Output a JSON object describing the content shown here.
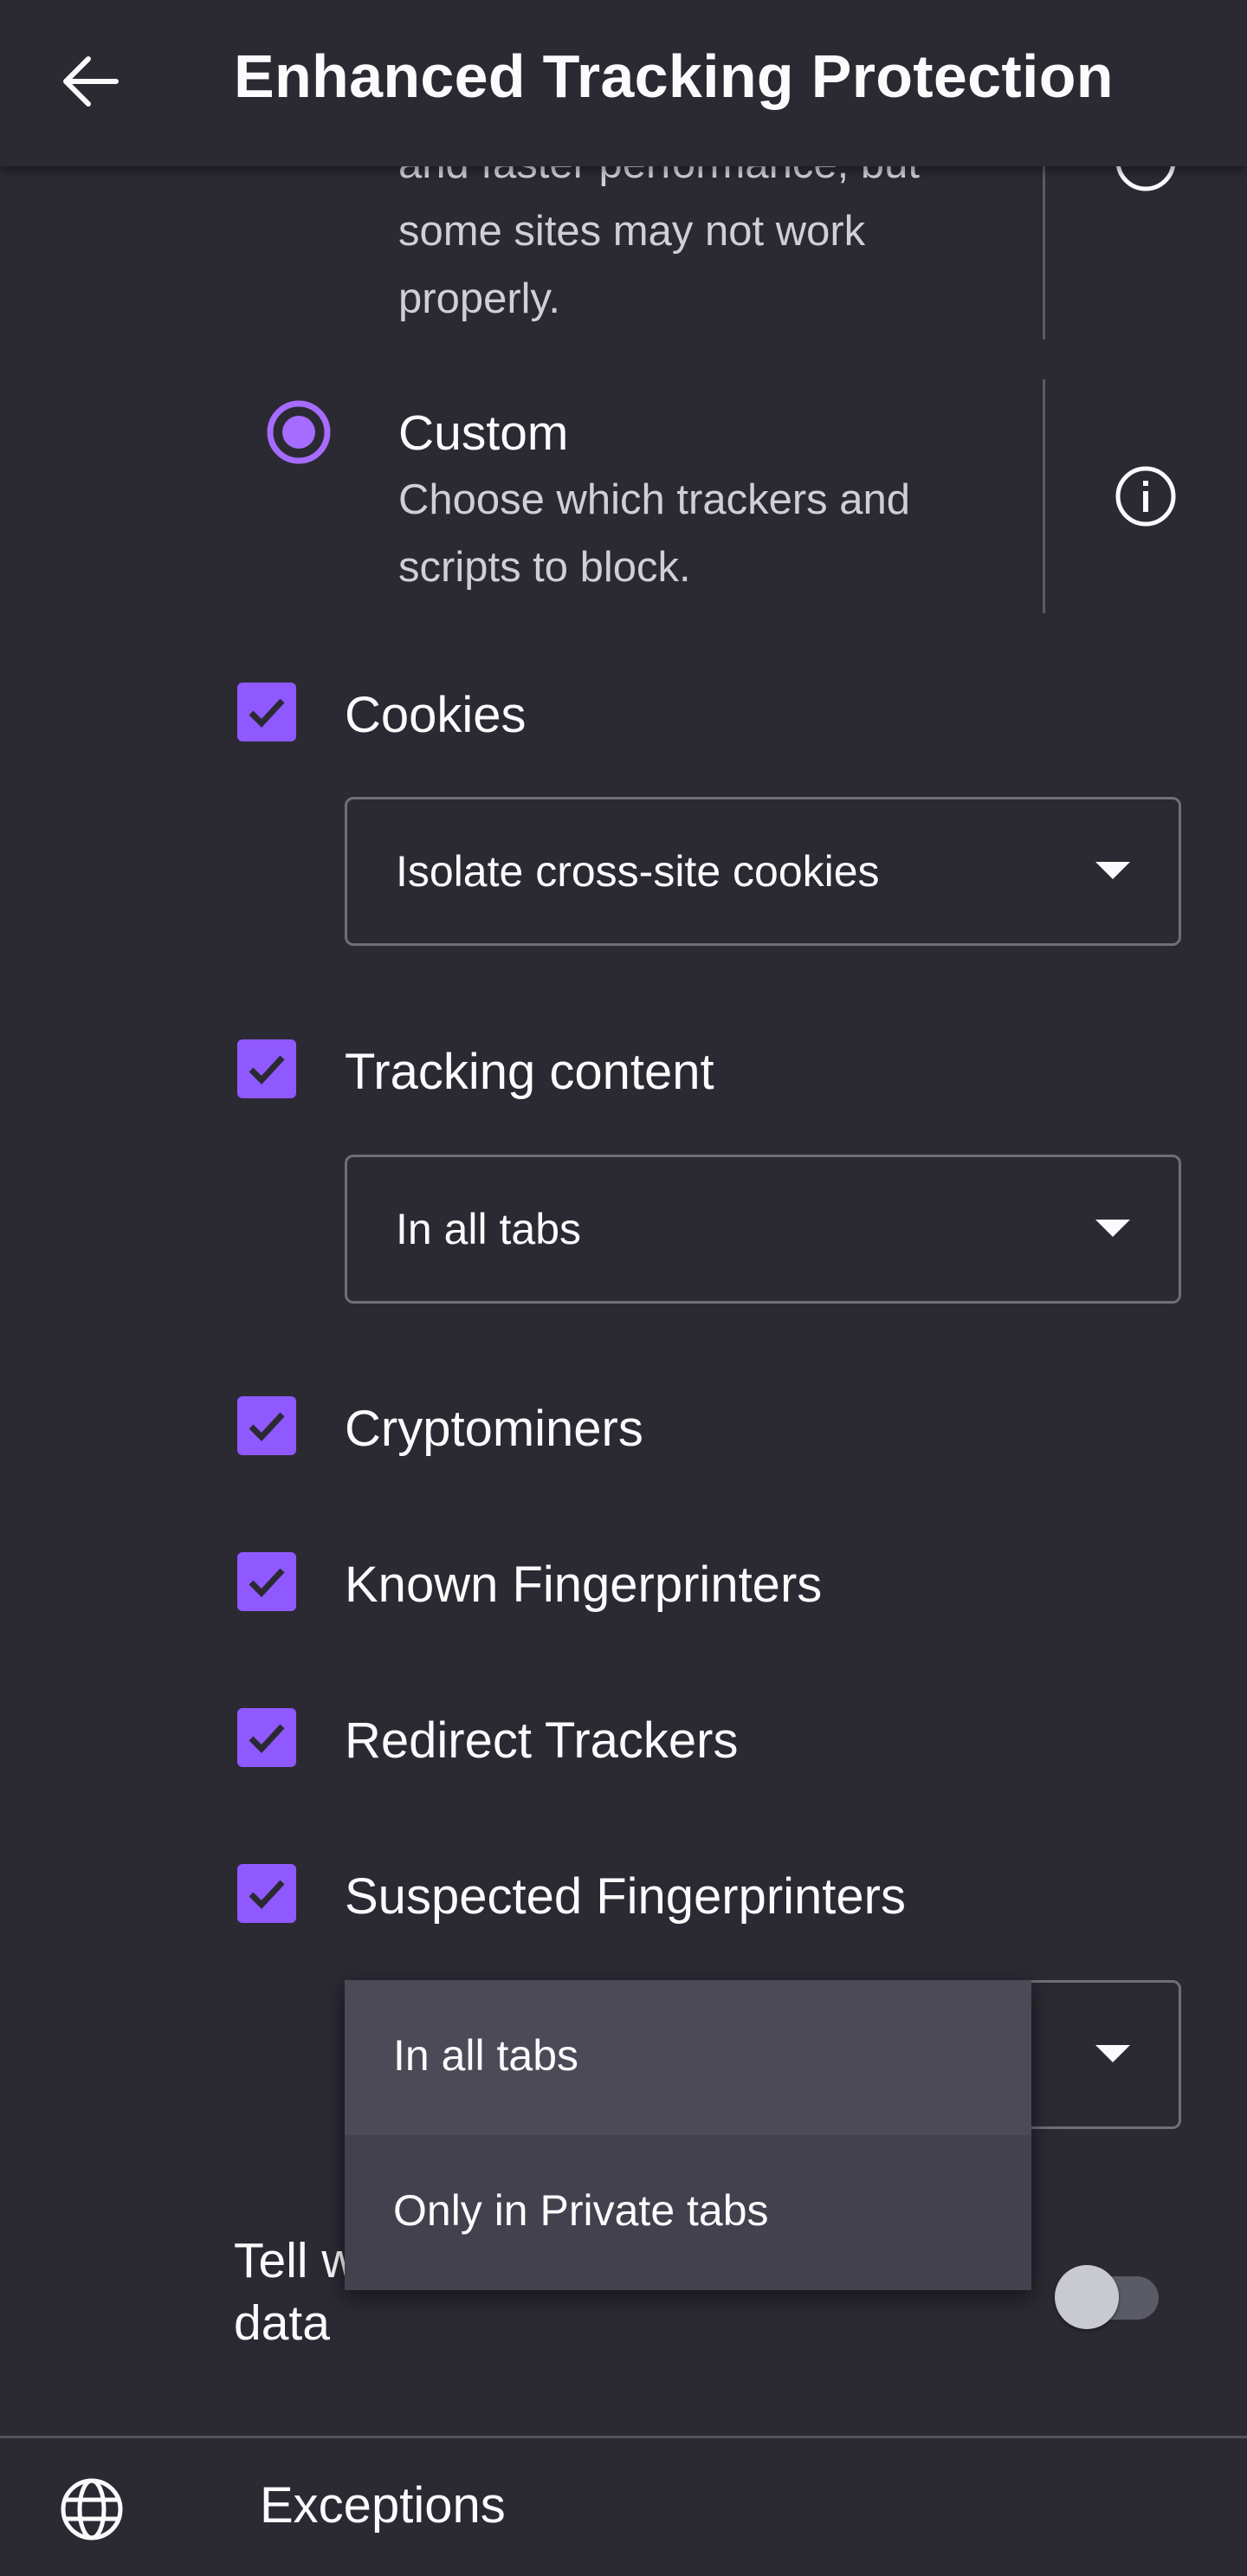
{
  "header": {
    "title": "Enhanced Tracking Protection",
    "back_icon": "arrow-left-icon"
  },
  "strict_option": {
    "description_lines": [
      "and faster performance, but",
      "some sites may not work",
      "properly."
    ]
  },
  "custom_option": {
    "title": "Custom",
    "description_lines": [
      "Choose which trackers and",
      "scripts to block."
    ],
    "selected": true
  },
  "checkboxes": [
    {
      "label": "Cookies",
      "checked": true
    },
    {
      "label": "Tracking content",
      "checked": true
    },
    {
      "label": "Cryptominers",
      "checked": true
    },
    {
      "label": "Known Fingerprinters",
      "checked": true
    },
    {
      "label": "Redirect Trackers",
      "checked": true
    },
    {
      "label": "Suspected Fingerprinters",
      "checked": true
    }
  ],
  "selects": {
    "cookies": "Isolate cross-site cookies",
    "tracking_content": "In all tabs"
  },
  "popup_menu": {
    "items": [
      "In all tabs",
      "Only in Private tabs"
    ],
    "highlighted_index": 0
  },
  "tell_row": {
    "line1": "Tell w",
    "line2": "data",
    "toggle_on": false
  },
  "exceptions": {
    "label": "Exceptions",
    "icon": "globe-icon"
  },
  "colors": {
    "background": "#2b2a33",
    "accent": "#9059ff",
    "accent_radio": "#a66bff",
    "popup": "#42414d"
  }
}
